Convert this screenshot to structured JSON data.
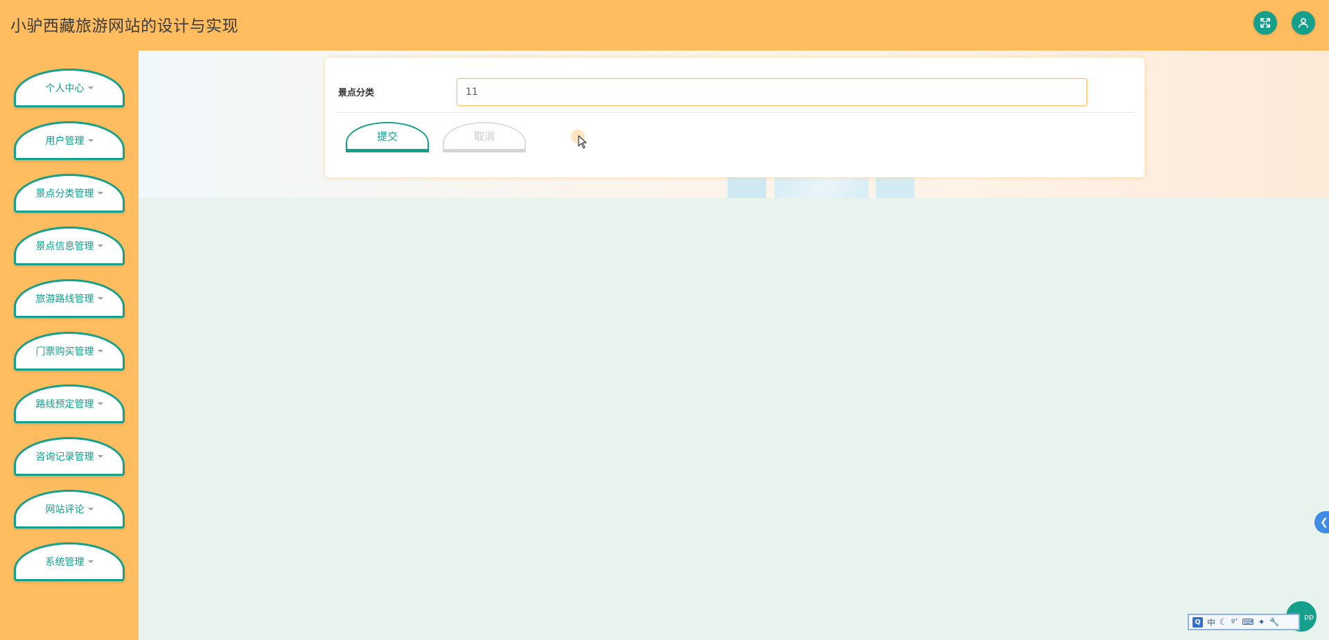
{
  "header": {
    "title": "小驴西藏旅游网站的设计与实现",
    "fullscreen_icon": "fullscreen-icon",
    "user_icon": "user-icon"
  },
  "sidebar": {
    "items": [
      {
        "label": "个人中心"
      },
      {
        "label": "用户管理"
      },
      {
        "label": "景点分类管理"
      },
      {
        "label": "景点信息管理"
      },
      {
        "label": "旅游路线管理"
      },
      {
        "label": "门票购买管理"
      },
      {
        "label": "路线预定管理"
      },
      {
        "label": "咨询记录管理"
      },
      {
        "label": "网站评论"
      },
      {
        "label": "系统管理"
      }
    ]
  },
  "form": {
    "field_label": "景点分类",
    "field_value": "11",
    "submit_label": "提交",
    "cancel_label": "取消"
  },
  "widgets": {
    "app_bubble_text": "pp",
    "ime": {
      "logo": "Q",
      "lang": "中"
    }
  },
  "colors": {
    "accent": "#14a08a",
    "header_bg": "#ffbd5f",
    "page_bg": "#e7f3ec"
  }
}
